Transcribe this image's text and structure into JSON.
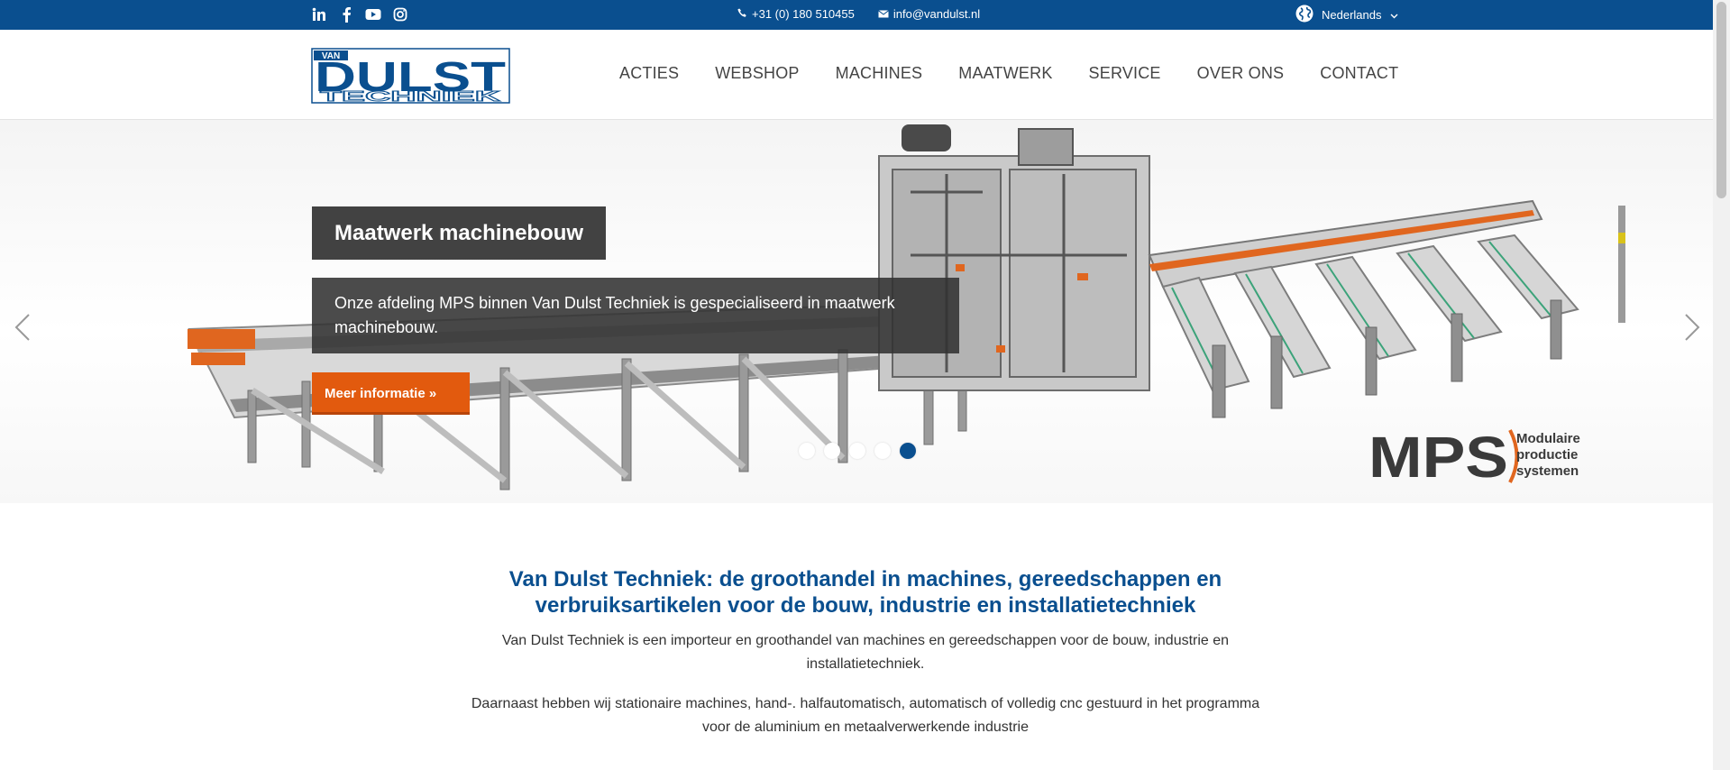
{
  "topbar": {
    "social_icons": [
      "linkedin-icon",
      "facebook-icon",
      "youtube-icon",
      "instagram-icon"
    ],
    "phone": "+31 (0) 180 510455",
    "email": "info@vandulst.nl",
    "language": "Nederlands"
  },
  "logo": {
    "top": "VAN",
    "main": "DULST",
    "sub": "TECHNIEK"
  },
  "nav": {
    "items": [
      "ACTIES",
      "WEBSHOP",
      "MACHINES",
      "MAATWERK",
      "SERVICE",
      "OVER ONS",
      "CONTACT"
    ]
  },
  "hero": {
    "title": "Maatwerk machinebouw",
    "text": "Onze afdeling MPS binnen Van Dulst Techniek is gespecialiseerd in maatwerk machinebouw.",
    "button_label": "Meer informatie  »",
    "slide_count": 5,
    "active_slide": 5,
    "mps_logo": {
      "mark": "MPS",
      "line1": "Modulaire",
      "line2": "productie",
      "line3": "systemen"
    }
  },
  "content": {
    "heading": "Van Dulst Techniek: de groothandel in machines, gereedschappen en verbruiksartikelen voor de bouw, industrie en installatietechniek",
    "paragraph1": "Van Dulst Techniek is een importeur en groothandel van machines en gereedschappen voor de bouw, industrie en installatietechniek.",
    "paragraph2": "Daarnaast hebben wij stationaire machines, hand-. halfautomatisch, automatisch of volledig cnc gestuurd in het programma voor de aluminium en metaalverwerkende industrie"
  },
  "colors": {
    "brand_blue": "#0a4f8f",
    "accent_orange": "#e25a0e",
    "dark_overlay": "#323232"
  }
}
